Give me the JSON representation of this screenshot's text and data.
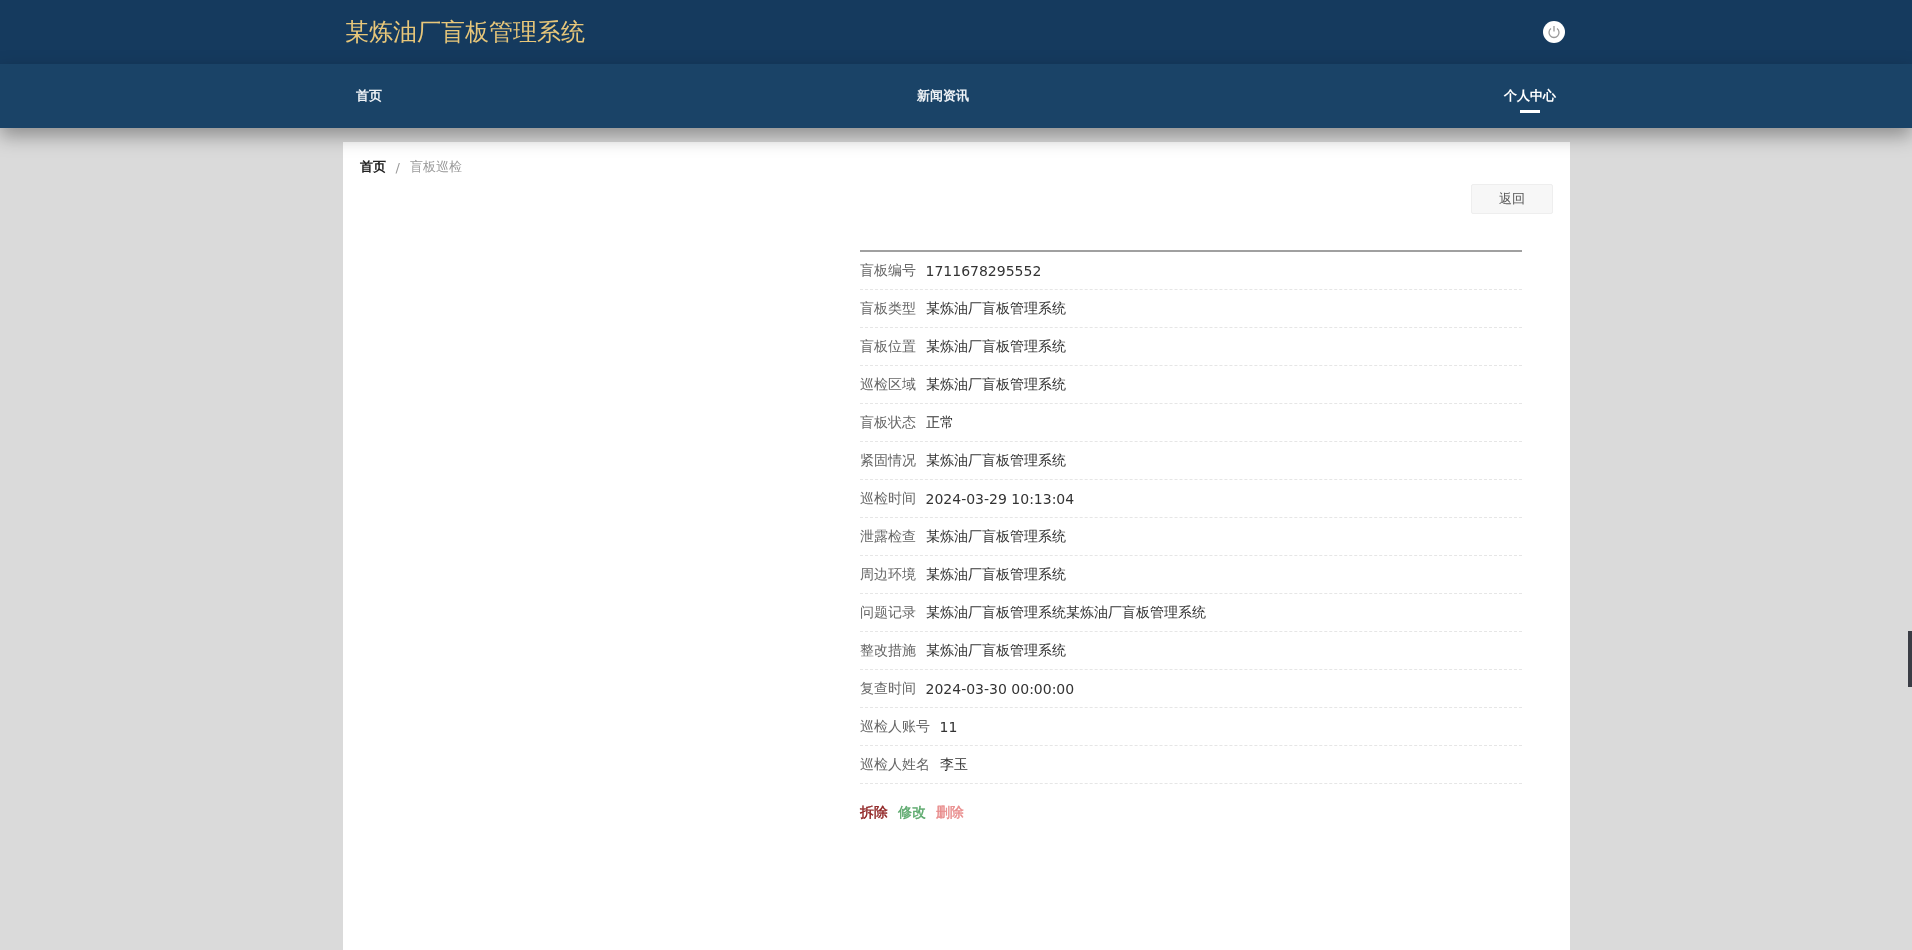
{
  "header": {
    "title": "某炼油厂盲板管理系统"
  },
  "nav": [
    {
      "label": "首页",
      "selected": false
    },
    {
      "label": "新闻资讯",
      "selected": false
    },
    {
      "label": "个人中心",
      "selected": true
    }
  ],
  "breadcrumb": {
    "home": "首页",
    "separator": "/",
    "current": "盲板巡检"
  },
  "back_button": "返回",
  "details": [
    {
      "label": "盲板编号",
      "value": "1711678295552"
    },
    {
      "label": "盲板类型",
      "value": "某炼油厂盲板管理系统"
    },
    {
      "label": "盲板位置",
      "value": "某炼油厂盲板管理系统"
    },
    {
      "label": "巡检区域",
      "value": "某炼油厂盲板管理系统"
    },
    {
      "label": "盲板状态",
      "value": "正常"
    },
    {
      "label": "紧固情况",
      "value": "某炼油厂盲板管理系统"
    },
    {
      "label": "巡检时间",
      "value": "2024-03-29 10:13:04"
    },
    {
      "label": "泄露检查",
      "value": "某炼油厂盲板管理系统"
    },
    {
      "label": "周边环境",
      "value": "某炼油厂盲板管理系统"
    },
    {
      "label": "问题记录",
      "value": "某炼油厂盲板管理系统某炼油厂盲板管理系统"
    },
    {
      "label": "整改措施",
      "value": "某炼油厂盲板管理系统"
    },
    {
      "label": "复查时间",
      "value": "2024-03-30 00:00:00"
    },
    {
      "label": "巡检人账号",
      "value": "11"
    },
    {
      "label": "巡检人姓名",
      "value": "李玉"
    }
  ],
  "actions": [
    {
      "label": "拆除",
      "color": "#8b1a1a"
    },
    {
      "label": "修改",
      "color": "#5aa86b"
    },
    {
      "label": "删除",
      "color": "#e88a8a"
    }
  ]
}
